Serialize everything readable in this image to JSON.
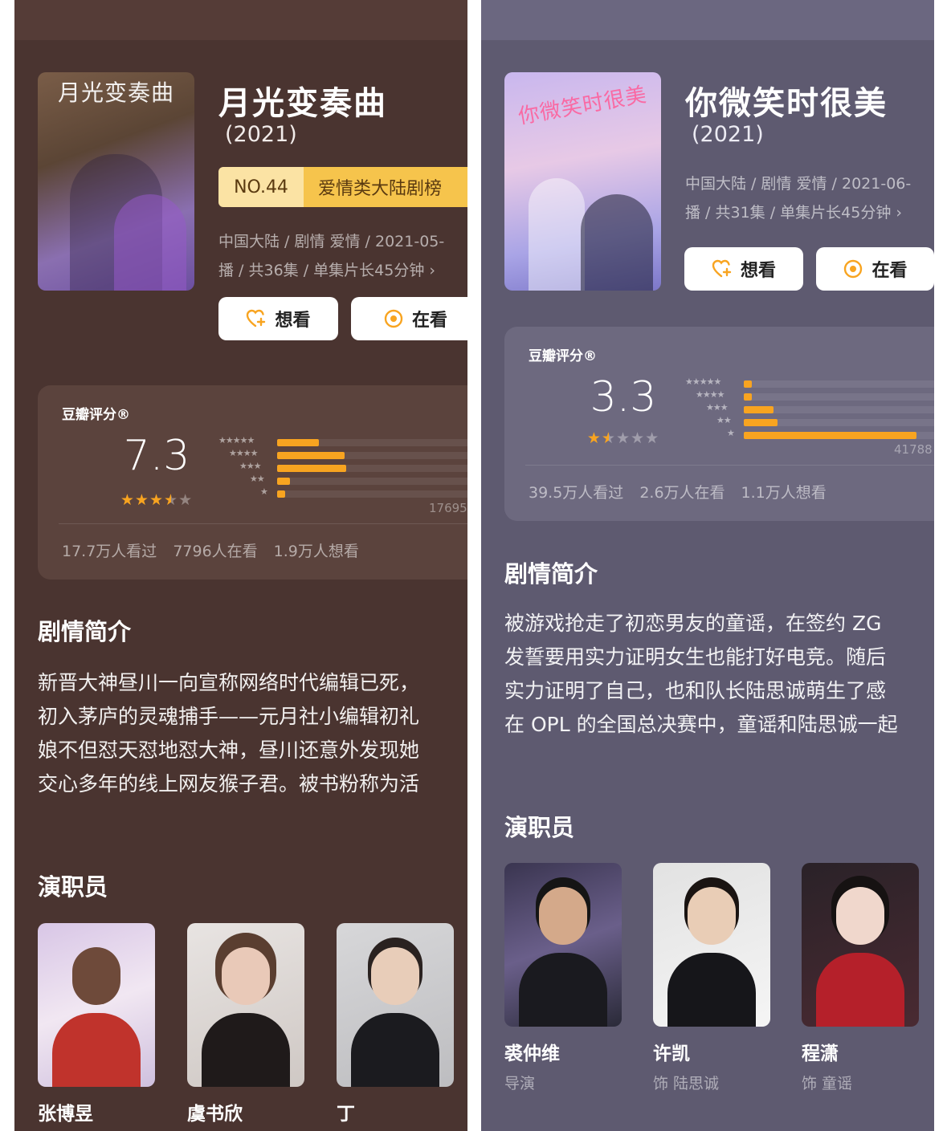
{
  "left": {
    "poster_title": "月光变奏曲",
    "title": "月光变奏曲",
    "year": "(2021)",
    "rank": {
      "no": "NO.44",
      "name": "爱情类大陆剧榜"
    },
    "meta_line1": "中国大陆 / 剧情 爱情 / 2021-05-",
    "meta_line2": "播 / 共36集 / 单集片长45分钟 ›",
    "want_label": "想看",
    "watching_label": "在看",
    "rating": {
      "label": "豆瓣评分®",
      "score": "7.3",
      "stars_value": 3.5,
      "distribution": [
        0.2,
        0.32,
        0.33,
        0.06,
        0.04
      ],
      "count": "17695",
      "stats": [
        "17.7万人看过",
        "7796人在看",
        "1.9万人想看"
      ]
    },
    "synopsis_title": "剧情简介",
    "synopsis_lines": [
      "新晋大神昼川一向宣称网络时代编辑已死，",
      "初入茅庐的灵魂捕手——元月社小编辑初礼",
      "娘不但怼天怼地怼大神，昼川还意外发现她",
      "交心多年的线上网友猴子君。被书粉称为活"
    ],
    "cast_title": "演职员",
    "cast": [
      {
        "name": "张博昱",
        "role": ""
      },
      {
        "name": "虞书欣",
        "role": ""
      },
      {
        "name": "丁",
        "role": ""
      }
    ]
  },
  "right": {
    "poster_title": "你微笑时很美",
    "title": "你微笑时很美",
    "year": "(2021)",
    "meta_line1": "中国大陆 / 剧情 爱情 / 2021-06-",
    "meta_line2": "播 / 共31集 / 单集片长45分钟 ›",
    "want_label": "想看",
    "watching_label": "在看",
    "rating": {
      "label": "豆瓣评分®",
      "score": "3.3",
      "stars_value": 1.5,
      "distribution": [
        0.04,
        0.04,
        0.14,
        0.16,
        0.82
      ],
      "count": "41788",
      "stats": [
        "39.5万人看过",
        "2.6万人在看",
        "1.1万人想看"
      ]
    },
    "synopsis_title": "剧情简介",
    "synopsis_lines": [
      "被游戏抢走了初恋男友的童谣，在签约 ZG",
      "发誓要用实力证明女生也能打好电竞。随后",
      "实力证明了自己，也和队长陆思诚萌生了感",
      "在 OPL 的全国总决赛中，童谣和陆思诚一起"
    ],
    "cast_title": "演职员",
    "cast": [
      {
        "name": "裘仲维",
        "role": "导演"
      },
      {
        "name": "许凯",
        "role": "饰 陆思诚"
      },
      {
        "name": "程潇",
        "role": "饰 童谣"
      }
    ]
  },
  "colors": {
    "accent": "#f8a420",
    "left_bg": "#4a3430",
    "right_bg": "#5e5a70"
  }
}
